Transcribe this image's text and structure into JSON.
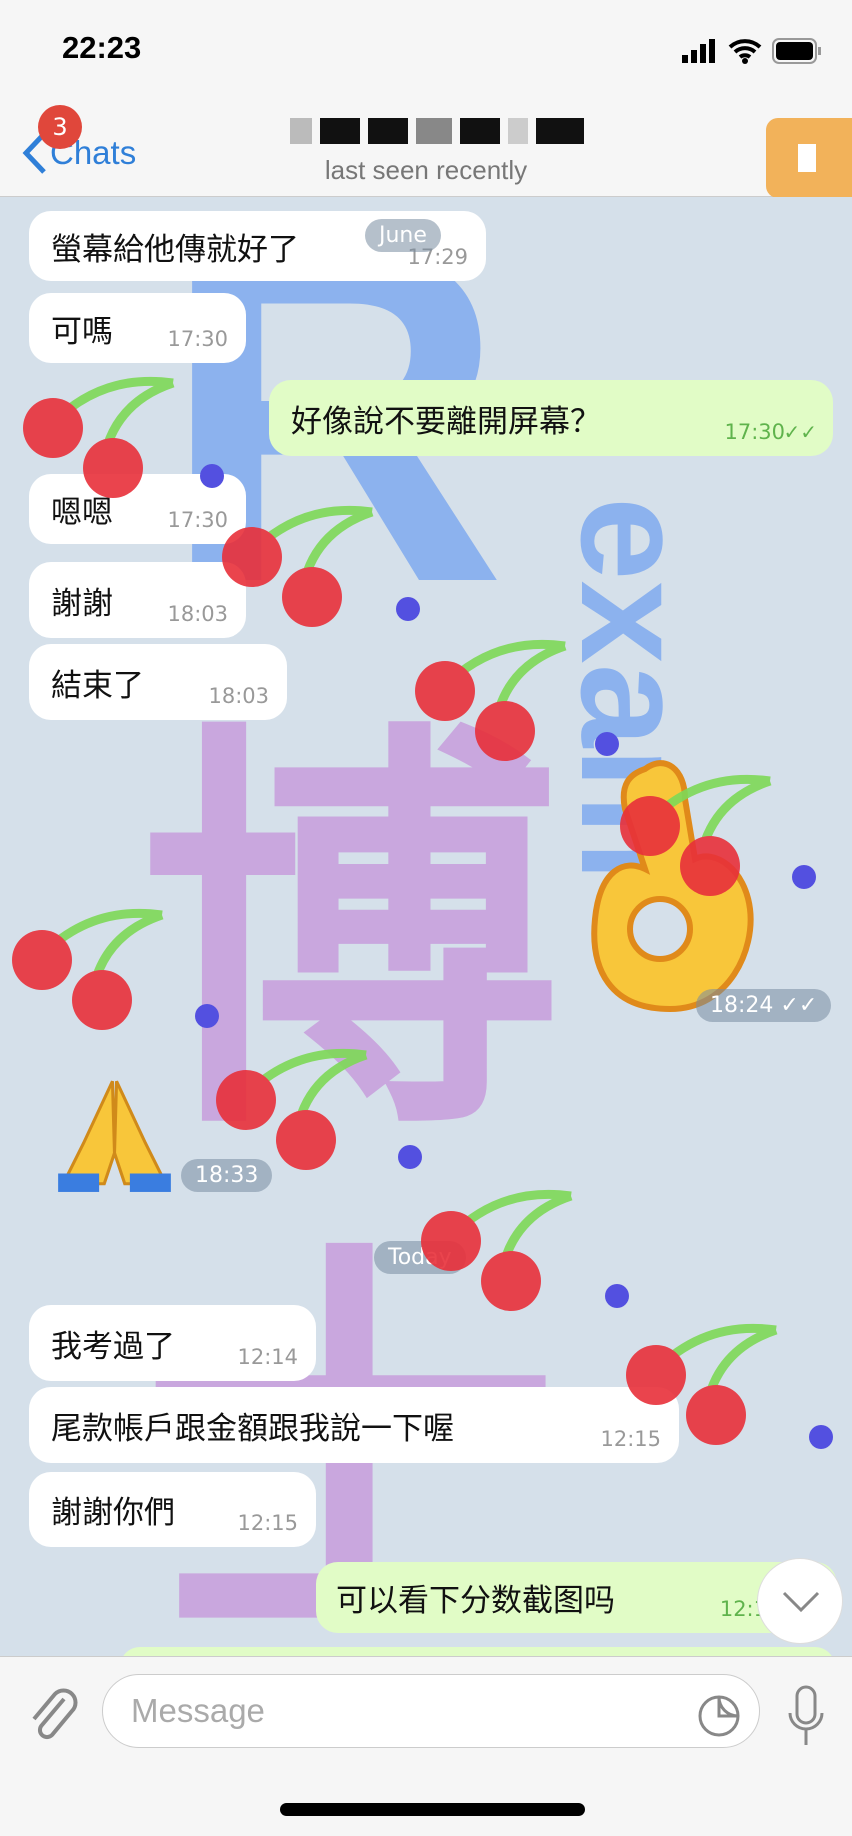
{
  "status_bar": {
    "time": "22:23"
  },
  "header": {
    "back_label": "Chats",
    "unread_badge": "3",
    "subtitle": "last seen recently"
  },
  "date_pills": {
    "june": "June",
    "today": "Today"
  },
  "messages": [
    {
      "dir": "in",
      "text": "螢幕給他傳就好了",
      "time": "17:29"
    },
    {
      "dir": "in",
      "text": "可嗎",
      "time": "17:30"
    },
    {
      "dir": "out",
      "text": "好像說不要離開屏幕？",
      "time": "17:30",
      "status": "read"
    },
    {
      "dir": "in",
      "text": "嗯嗯",
      "time": "17:30"
    },
    {
      "dir": "in",
      "text": "謝謝",
      "time": "18:03"
    },
    {
      "dir": "in",
      "text": "結束了",
      "time": "18:03"
    },
    {
      "dir": "out",
      "emoji": "ok-hand",
      "time": "18:24",
      "status": "read"
    },
    {
      "dir": "in",
      "emoji": "folded-hands",
      "time": "18:33"
    },
    {
      "dir": "in",
      "text": "我考過了",
      "time": "12:14"
    },
    {
      "dir": "in",
      "text": "尾款帳戶跟金額跟我說一下喔",
      "time": "12:15"
    },
    {
      "dir": "in",
      "text": "謝謝你們",
      "time": "12:15"
    },
    {
      "dir": "out",
      "text": "可以看下分数截图吗",
      "time": "12:1"
    }
  ],
  "watermark": {
    "letter": "R",
    "side_text": "exam",
    "chars": "博士"
  },
  "input": {
    "placeholder": "Message"
  },
  "colors": {
    "accent": "#2f7fd8",
    "badge": "#e0473b",
    "outgoing": "#e1fcc6",
    "chat_bg": "#d5e0ea"
  }
}
